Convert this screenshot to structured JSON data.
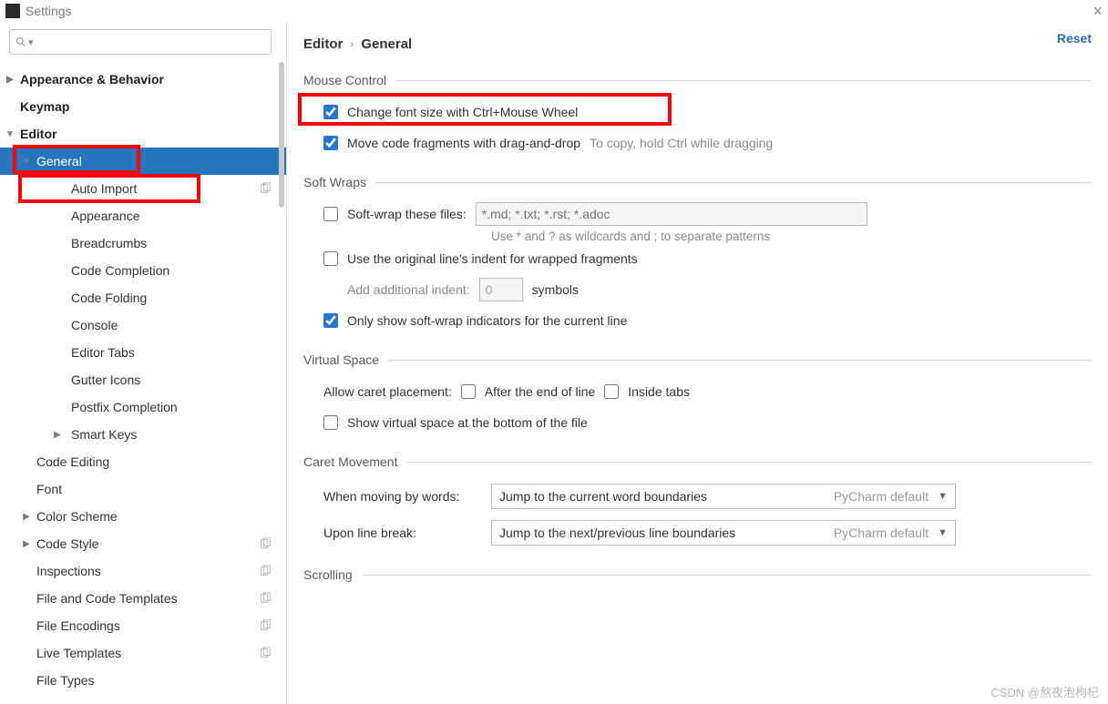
{
  "window": {
    "title": "Settings",
    "close_glyph": "×"
  },
  "search": {
    "placeholder": "",
    "icon": "search-icon"
  },
  "sidebar": {
    "items": [
      {
        "label": "Appearance & Behavior",
        "level": 0,
        "expandable": true,
        "expanded": false
      },
      {
        "label": "Keymap",
        "level": 0
      },
      {
        "label": "Editor",
        "level": 0,
        "expandable": true,
        "expanded": true
      },
      {
        "label": "General",
        "level": 1,
        "expandable": true,
        "expanded": true,
        "selected": true
      },
      {
        "label": "Auto Import",
        "level": 2,
        "copy": true
      },
      {
        "label": "Appearance",
        "level": 2
      },
      {
        "label": "Breadcrumbs",
        "level": 2
      },
      {
        "label": "Code Completion",
        "level": 2
      },
      {
        "label": "Code Folding",
        "level": 2
      },
      {
        "label": "Console",
        "level": 2
      },
      {
        "label": "Editor Tabs",
        "level": 2
      },
      {
        "label": "Gutter Icons",
        "level": 2
      },
      {
        "label": "Postfix Completion",
        "level": 2
      },
      {
        "label": "Smart Keys",
        "level": 2,
        "expandable": true,
        "expanded": false
      },
      {
        "label": "Code Editing",
        "level": 1
      },
      {
        "label": "Font",
        "level": 1
      },
      {
        "label": "Color Scheme",
        "level": 1,
        "expandable": true,
        "expanded": false
      },
      {
        "label": "Code Style",
        "level": 1,
        "expandable": true,
        "expanded": false,
        "copy": true
      },
      {
        "label": "Inspections",
        "level": 1,
        "copy": true
      },
      {
        "label": "File and Code Templates",
        "level": 1,
        "copy": true
      },
      {
        "label": "File Encodings",
        "level": 1,
        "copy": true
      },
      {
        "label": "Live Templates",
        "level": 1,
        "copy": true
      },
      {
        "label": "File Types",
        "level": 1
      }
    ]
  },
  "breadcrumb": {
    "seg1": "Editor",
    "seg2": "General"
  },
  "reset_label": "Reset",
  "groups": {
    "mouse": {
      "legend": "Mouse Control",
      "opt1": {
        "label": "Change font size with Ctrl+Mouse Wheel",
        "checked": true
      },
      "opt2": {
        "label": "Move code fragments with drag-and-drop",
        "checked": true,
        "hint": "To copy, hold Ctrl while dragging"
      }
    },
    "softwraps": {
      "legend": "Soft Wraps",
      "opt1": {
        "label": "Soft-wrap these files:",
        "checked": false,
        "placeholder": "*.md; *.txt; *.rst; *.adoc"
      },
      "hint": "Use * and ? as wildcards and ; to separate patterns",
      "opt2": {
        "label": "Use the original line's indent for wrapped fragments",
        "checked": false
      },
      "indent_label": "Add additional indent:",
      "indent_value": "0",
      "indent_unit": "symbols",
      "opt3": {
        "label": "Only show soft-wrap indicators for the current line",
        "checked": true
      }
    },
    "virtual": {
      "legend": "Virtual Space",
      "allow_label": "Allow caret placement:",
      "opt1": {
        "label": "After the end of line",
        "checked": false
      },
      "opt2": {
        "label": "Inside tabs",
        "checked": false
      },
      "opt3": {
        "label": "Show virtual space at the bottom of the file",
        "checked": false
      }
    },
    "caret": {
      "legend": "Caret Movement",
      "row1": {
        "label": "When moving by words:",
        "value": "Jump to the current word boundaries",
        "suffix": "PyCharm default"
      },
      "row2": {
        "label": "Upon line break:",
        "value": "Jump to the next/previous line boundaries",
        "suffix": "PyCharm default"
      }
    },
    "scrolling": {
      "legend": "Scrolling"
    }
  },
  "watermark": "CSDN @熬夜泡枸杞"
}
